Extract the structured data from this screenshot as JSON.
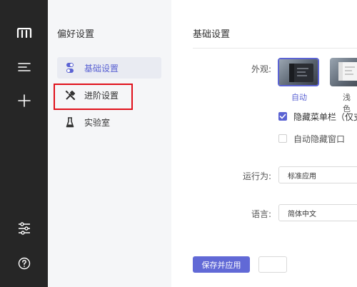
{
  "rail": {
    "icons": [
      "app-logo-icon",
      "menu-lines-icon",
      "plus-icon",
      "sliders-icon",
      "help-circle-icon"
    ]
  },
  "nav": {
    "title": "偏好设置",
    "items": [
      {
        "label": "基础设置",
        "icon": "toggle-icon",
        "active": true
      },
      {
        "label": "进阶设置",
        "icon": "tools-icon",
        "active": false
      },
      {
        "label": "实验室",
        "icon": "flask-icon",
        "active": false
      }
    ],
    "highlight_color": "#e0101a"
  },
  "main": {
    "title": "基础设置",
    "appearance": {
      "label": "外观:",
      "options": [
        {
          "caption": "自动",
          "selected": true
        },
        {
          "caption": "浅色",
          "selected": false
        }
      ]
    },
    "checkboxes": [
      {
        "label": "隐藏菜单栏（仅支",
        "checked": true
      },
      {
        "label": "自动隐藏窗口",
        "checked": false
      }
    ],
    "run_as": {
      "label": "运行为:",
      "value": "标准应用"
    },
    "language": {
      "label": "语言:",
      "value": "简体中文"
    },
    "save_button": "保存并应用"
  },
  "colors": {
    "accent": "#5b63d3",
    "rail_bg": "#262626",
    "nav_bg": "#f5f6f8"
  }
}
